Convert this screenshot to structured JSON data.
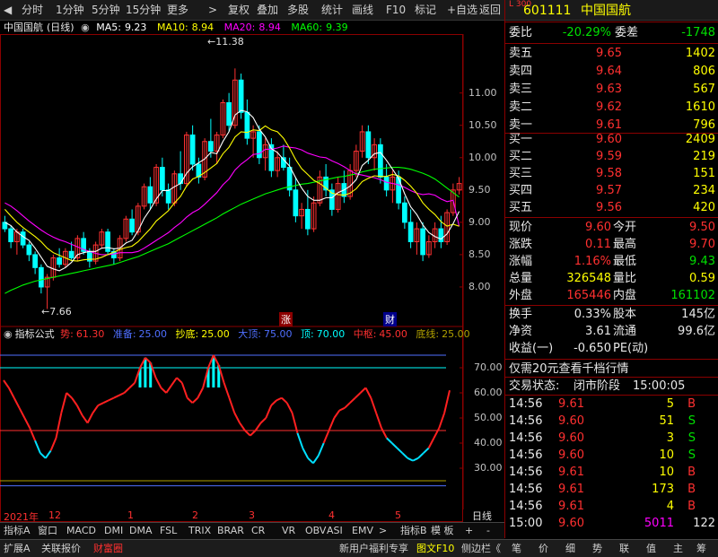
{
  "toolbar": {
    "items": [
      "分时",
      "1分钟",
      "5分钟",
      "15分钟",
      "更多",
      ">",
      "复权",
      "叠加",
      "多股",
      "统计",
      "画线",
      "F10",
      "标记",
      "+自选",
      "返回"
    ]
  },
  "main_chart": {
    "stock_name": "中国国航",
    "period": "(日线)",
    "ma5_label": "MA5:",
    "ma5": "9.23",
    "ma10_label": "MA10:",
    "ma10": "8.94",
    "ma20_label": "MA20:",
    "ma20": "8.94",
    "ma60_label": "MA60:",
    "ma60": "9.39",
    "high_note": "11.38",
    "low_note": "7.66",
    "zhang_marker": "涨",
    "cai_marker": "财",
    "price_ticks": [
      "11.00",
      "10.50",
      "10.00",
      "9.50",
      "9.00",
      "8.50",
      "8.00"
    ],
    "colors": {
      "ma5": "#ffffff",
      "ma10": "#ffff00",
      "ma20": "#ff00ff",
      "ma60": "#00ff00",
      "up": "#ff3232",
      "down": "#00ffff"
    }
  },
  "indicator": {
    "title": "指标公式",
    "shi_label": "势:",
    "shi": "61.30",
    "zhunbei_label": "准备:",
    "zhunbei": "25.00",
    "chaodi_label": "抄底:",
    "chaodi": "25.00",
    "dading_label": "大顶:",
    "dading": "75.00",
    "ding_label": "顶:",
    "ding": "70.00",
    "zhongshu_label": "中枢:",
    "zhongshu": "45.00",
    "dixian_label": "底线:",
    "dixian": "25.00",
    "ticks": [
      "70.00",
      "60.00",
      "50.00",
      "40.00",
      "30.00"
    ]
  },
  "time_axis": {
    "labels": [
      "2021年",
      "12",
      "1",
      "2",
      "3",
      "4",
      "5"
    ],
    "right_label": "日线"
  },
  "tabs": [
    "指标A",
    "窗口",
    "MACD",
    "DMI",
    "DMA",
    "FSL",
    "TRIX",
    "BRAR",
    "CR",
    "VR",
    "OBV",
    "ASI",
    "EMV",
    ">",
    "指标B",
    "模 板",
    "+",
    "-"
  ],
  "status": {
    "left": [
      "扩展A",
      "关联报价",
      "财富圈"
    ],
    "ad": "新用户福利专享",
    "right": [
      "图文F10",
      "侧边栏《",
      "笔",
      "价",
      "细",
      "势",
      "联",
      "值",
      "主",
      "筹"
    ]
  },
  "quote": {
    "code_label": "L 300",
    "code": "601111",
    "name": "中国国航",
    "weibi_label": "委比",
    "weibi": "-20.29%",
    "weicha_label": "委差",
    "weicha": "-1748",
    "sell": [
      {
        "label": "卖五",
        "price": "9.65",
        "vol": "1402"
      },
      {
        "label": "卖四",
        "price": "9.64",
        "vol": "806"
      },
      {
        "label": "卖三",
        "price": "9.63",
        "vol": "567"
      },
      {
        "label": "卖二",
        "price": "9.62",
        "vol": "1610"
      },
      {
        "label": "卖一",
        "price": "9.61",
        "vol": "796"
      }
    ],
    "buy": [
      {
        "label": "买一",
        "price": "9.60",
        "vol": "2409"
      },
      {
        "label": "买二",
        "price": "9.59",
        "vol": "219"
      },
      {
        "label": "买三",
        "price": "9.58",
        "vol": "151"
      },
      {
        "label": "买四",
        "price": "9.57",
        "vol": "234"
      },
      {
        "label": "买五",
        "price": "9.56",
        "vol": "420"
      }
    ],
    "stats": [
      {
        "l1": "现价",
        "v1": "9.60",
        "l2": "今开",
        "v2": "9.50",
        "c1": "red",
        "c2": "red"
      },
      {
        "l1": "涨跌",
        "v1": "0.11",
        "l2": "最高",
        "v2": "9.70",
        "c1": "red",
        "c2": "red"
      },
      {
        "l1": "涨幅",
        "v1": "1.16%",
        "l2": "最低",
        "v2": "9.43",
        "c1": "red",
        "c2": "green"
      },
      {
        "l1": "总量",
        "v1": "326548",
        "l2": "量比",
        "v2": "0.59",
        "c1": "yellow",
        "c2": "yellow"
      },
      {
        "l1": "外盘",
        "v1": "165446",
        "l2": "内盘",
        "v2": "161102",
        "c1": "red",
        "c2": "green"
      }
    ],
    "extra": [
      {
        "l1": "换手",
        "v1": "0.33%",
        "l2": "股本",
        "v2": "145亿"
      },
      {
        "l1": "净资",
        "v1": "3.61",
        "l2": "流通",
        "v2": "99.6亿"
      },
      {
        "l1": "收益(一)",
        "v1": "-0.650",
        "l2": "PE(动)",
        "v2": ""
      }
    ],
    "promo": "仅需20元查看千档行情",
    "trade_status_label": "交易状态:",
    "trade_status": "闭市阶段",
    "trade_time": "15:00:05",
    "ticks": [
      {
        "t": "14:56",
        "p": "9.61",
        "v": "5",
        "bs": "B"
      },
      {
        "t": "14:56",
        "p": "9.60",
        "v": "51",
        "bs": "S"
      },
      {
        "t": "14:56",
        "p": "9.60",
        "v": "3",
        "bs": "S"
      },
      {
        "t": "14:56",
        "p": "9.60",
        "v": "10",
        "bs": "S"
      },
      {
        "t": "14:56",
        "p": "9.61",
        "v": "10",
        "bs": "B"
      },
      {
        "t": "14:56",
        "p": "9.61",
        "v": "173",
        "bs": "B"
      },
      {
        "t": "14:56",
        "p": "9.61",
        "v": "4",
        "bs": "B"
      },
      {
        "t": "15:00",
        "p": "9.60",
        "v": "5011",
        "bs": "",
        "n": "122"
      }
    ]
  },
  "chart_data": {
    "type": "candlestick",
    "ylim": [
      7.5,
      11.8
    ],
    "candles": [
      [
        9.0,
        9.1,
        8.85,
        8.9
      ],
      [
        8.9,
        8.95,
        8.6,
        8.7
      ],
      [
        8.7,
        8.9,
        8.5,
        8.85
      ],
      [
        8.85,
        8.9,
        8.6,
        8.65
      ],
      [
        8.65,
        8.7,
        8.4,
        8.5
      ],
      [
        8.5,
        8.55,
        8.2,
        8.3
      ],
      [
        8.3,
        8.35,
        7.9,
        8.0
      ],
      [
        8.0,
        8.2,
        7.66,
        8.15
      ],
      [
        8.15,
        8.5,
        8.1,
        8.45
      ],
      [
        8.45,
        8.6,
        8.3,
        8.35
      ],
      [
        8.35,
        8.6,
        8.3,
        8.55
      ],
      [
        8.55,
        8.7,
        8.4,
        8.45
      ],
      [
        8.45,
        8.8,
        8.4,
        8.75
      ],
      [
        8.75,
        8.85,
        8.5,
        8.55
      ],
      [
        8.55,
        8.6,
        8.3,
        8.4
      ],
      [
        8.4,
        8.7,
        8.35,
        8.65
      ],
      [
        8.65,
        8.9,
        8.6,
        8.85
      ],
      [
        8.85,
        8.9,
        8.5,
        8.55
      ],
      [
        8.55,
        8.6,
        8.35,
        8.45
      ],
      [
        8.45,
        8.8,
        8.4,
        8.75
      ],
      [
        8.75,
        9.1,
        8.7,
        9.05
      ],
      [
        9.05,
        9.2,
        8.8,
        8.85
      ],
      [
        8.85,
        9.3,
        8.8,
        9.25
      ],
      [
        9.25,
        9.6,
        9.2,
        9.55
      ],
      [
        9.55,
        9.7,
        9.2,
        9.3
      ],
      [
        9.3,
        9.9,
        9.25,
        9.85
      ],
      [
        9.85,
        10.0,
        9.4,
        9.5
      ],
      [
        9.5,
        9.6,
        9.2,
        9.3
      ],
      [
        9.3,
        9.8,
        9.25,
        9.75
      ],
      [
        9.75,
        10.1,
        9.5,
        9.6
      ],
      [
        9.6,
        10.4,
        9.55,
        10.35
      ],
      [
        10.35,
        10.5,
        9.8,
        9.9
      ],
      [
        9.9,
        10.0,
        9.6,
        9.7
      ],
      [
        9.7,
        10.3,
        9.65,
        10.25
      ],
      [
        10.25,
        10.6,
        10.0,
        10.1
      ],
      [
        10.1,
        10.4,
        9.9,
        10.35
      ],
      [
        10.35,
        10.9,
        10.3,
        10.85
      ],
      [
        10.85,
        11.0,
        10.4,
        10.5
      ],
      [
        10.5,
        11.38,
        10.45,
        11.2
      ],
      [
        11.2,
        11.3,
        10.6,
        10.7
      ],
      [
        10.7,
        10.9,
        10.2,
        10.3
      ],
      [
        10.3,
        10.5,
        10.0,
        10.4
      ],
      [
        10.4,
        10.5,
        9.9,
        10.0
      ],
      [
        10.0,
        10.3,
        9.8,
        10.2
      ],
      [
        10.2,
        10.3,
        9.7,
        9.8
      ],
      [
        9.8,
        10.1,
        9.7,
        10.0
      ],
      [
        10.0,
        10.2,
        9.8,
        9.85
      ],
      [
        9.85,
        10.0,
        9.4,
        9.5
      ],
      [
        9.5,
        9.7,
        9.0,
        9.1
      ],
      [
        9.1,
        9.3,
        8.9,
        9.2
      ],
      [
        9.2,
        9.5,
        8.8,
        8.9
      ],
      [
        8.9,
        9.4,
        8.85,
        9.3
      ],
      [
        9.3,
        9.8,
        9.25,
        9.7
      ],
      [
        9.7,
        9.9,
        9.4,
        9.5
      ],
      [
        9.5,
        9.6,
        9.1,
        9.2
      ],
      [
        9.2,
        9.7,
        9.15,
        9.6
      ],
      [
        9.6,
        9.8,
        9.3,
        9.4
      ],
      [
        9.4,
        9.9,
        9.35,
        9.8
      ],
      [
        9.8,
        10.2,
        9.7,
        10.1
      ],
      [
        10.1,
        10.5,
        10.0,
        10.4
      ],
      [
        10.4,
        10.5,
        9.9,
        10.0
      ],
      [
        10.0,
        10.3,
        9.8,
        10.2
      ],
      [
        10.2,
        10.3,
        9.6,
        9.7
      ],
      [
        9.7,
        9.9,
        9.4,
        9.5
      ],
      [
        9.5,
        9.8,
        9.3,
        9.7
      ],
      [
        9.7,
        9.8,
        9.2,
        9.3
      ],
      [
        9.3,
        9.4,
        8.9,
        9.0
      ],
      [
        9.0,
        9.2,
        8.6,
        8.7
      ],
      [
        8.7,
        9.0,
        8.5,
        8.9
      ],
      [
        8.9,
        9.0,
        8.4,
        8.5
      ],
      [
        8.5,
        8.8,
        8.45,
        8.7
      ],
      [
        8.7,
        9.0,
        8.6,
        8.9
      ],
      [
        8.9,
        9.1,
        8.6,
        8.7
      ],
      [
        8.7,
        9.2,
        8.65,
        9.15
      ],
      [
        9.15,
        9.6,
        9.1,
        9.5
      ],
      [
        9.5,
        9.7,
        9.43,
        9.6
      ]
    ],
    "ma5": [
      9.0,
      8.95,
      8.85,
      8.78,
      8.72,
      8.6,
      8.46,
      8.32,
      8.28,
      8.25,
      8.3,
      8.38,
      8.5,
      8.53,
      8.55,
      8.55,
      8.6,
      8.61,
      8.59,
      8.6,
      8.68,
      8.72,
      8.87,
      9.06,
      9.2,
      9.36,
      9.49,
      9.49,
      9.55,
      9.6,
      9.76,
      9.86,
      9.92,
      9.98,
      10.08,
      10.06,
      10.25,
      10.4,
      10.66,
      10.73,
      10.71,
      10.62,
      10.44,
      10.32,
      10.14,
      10.08,
      9.97,
      9.87,
      9.69,
      9.53,
      9.4,
      9.34,
      9.34,
      9.38,
      9.38,
      9.46,
      9.5,
      9.56,
      9.66,
      9.88,
      9.96,
      10.06,
      10.08,
      9.96,
      9.82,
      9.68,
      9.44,
      9.24,
      9.12,
      8.96,
      8.84,
      8.78,
      8.74,
      8.82,
      8.98,
      9.17
    ],
    "ma10": [
      9.2,
      9.1,
      9.0,
      8.92,
      8.85,
      8.78,
      8.7,
      8.6,
      8.53,
      8.49,
      8.45,
      8.41,
      8.4,
      8.42,
      8.43,
      8.43,
      8.46,
      8.5,
      8.54,
      8.58,
      8.61,
      8.63,
      8.7,
      8.8,
      8.9,
      9.02,
      9.1,
      9.18,
      9.3,
      9.4,
      9.56,
      9.67,
      9.71,
      9.77,
      9.84,
      9.91,
      10.06,
      10.16,
      10.32,
      10.4,
      10.39,
      10.43,
      10.42,
      10.49,
      10.43,
      10.4,
      10.3,
      10.15,
      9.97,
      9.83,
      9.74,
      9.65,
      9.6,
      9.53,
      9.45,
      9.43,
      9.42,
      9.45,
      9.52,
      9.63,
      9.68,
      9.72,
      9.71,
      9.71,
      9.74,
      9.72,
      9.65,
      9.56,
      9.45,
      9.3,
      9.2,
      9.12,
      9.01,
      8.94,
      8.97,
      8.94
    ],
    "ma20": [
      9.3,
      9.25,
      9.18,
      9.1,
      9.02,
      8.95,
      8.88,
      8.82,
      8.77,
      8.73,
      8.7,
      8.66,
      8.62,
      8.58,
      8.55,
      8.52,
      8.5,
      8.5,
      8.51,
      8.53,
      8.53,
      8.53,
      8.55,
      8.6,
      8.66,
      8.72,
      8.78,
      8.84,
      8.92,
      8.99,
      9.08,
      9.15,
      9.2,
      9.28,
      9.37,
      9.46,
      9.58,
      9.67,
      9.81,
      9.9,
      9.97,
      10.05,
      10.06,
      10.13,
      10.13,
      10.15,
      10.18,
      10.16,
      10.15,
      10.12,
      10.07,
      10.04,
      10.01,
      10.0,
      9.95,
      9.91,
      9.86,
      9.8,
      9.75,
      9.73,
      9.71,
      9.69,
      9.66,
      9.62,
      9.6,
      9.58,
      9.54,
      9.49,
      9.45,
      9.43,
      9.44,
      9.42,
      9.36,
      9.32,
      9.34,
      8.94
    ],
    "ma60": [
      7.9,
      7.95,
      7.99,
      8.03,
      8.06,
      8.09,
      8.11,
      8.13,
      8.15,
      8.17,
      8.19,
      8.21,
      8.23,
      8.25,
      8.27,
      8.29,
      8.31,
      8.33,
      8.35,
      8.38,
      8.41,
      8.44,
      8.47,
      8.51,
      8.55,
      8.59,
      8.63,
      8.67,
      8.72,
      8.77,
      8.82,
      8.87,
      8.92,
      8.97,
      9.02,
      9.07,
      9.13,
      9.18,
      9.23,
      9.28,
      9.32,
      9.36,
      9.4,
      9.44,
      9.47,
      9.5,
      9.53,
      9.55,
      9.57,
      9.59,
      9.6,
      9.62,
      9.64,
      9.66,
      9.68,
      9.7,
      9.71,
      9.73,
      9.75,
      9.78,
      9.8,
      9.82,
      9.83,
      9.84,
      9.85,
      9.85,
      9.84,
      9.82,
      9.79,
      9.76,
      9.72,
      9.67,
      9.6,
      9.53,
      9.46,
      9.39
    ],
    "indicator_line": [
      65,
      62,
      58,
      54,
      50,
      46,
      41,
      36,
      34,
      37,
      42,
      52,
      60,
      58,
      55,
      51,
      48,
      52,
      55,
      56,
      57,
      58,
      59,
      60,
      62,
      64,
      70,
      74,
      72,
      66,
      62,
      60,
      63,
      66,
      64,
      58,
      56,
      58,
      62,
      70,
      75,
      71,
      64,
      58,
      52,
      48,
      45,
      43,
      45,
      48,
      50,
      55,
      57,
      58,
      56,
      52,
      44,
      38,
      34,
      32,
      35,
      40,
      45,
      50,
      53,
      54,
      56,
      58,
      60,
      62,
      58,
      52,
      46,
      42,
      40,
      38,
      36,
      34,
      33,
      34,
      36,
      38,
      42,
      46,
      52,
      61
    ],
    "ind_ylim": [
      20,
      80
    ]
  }
}
